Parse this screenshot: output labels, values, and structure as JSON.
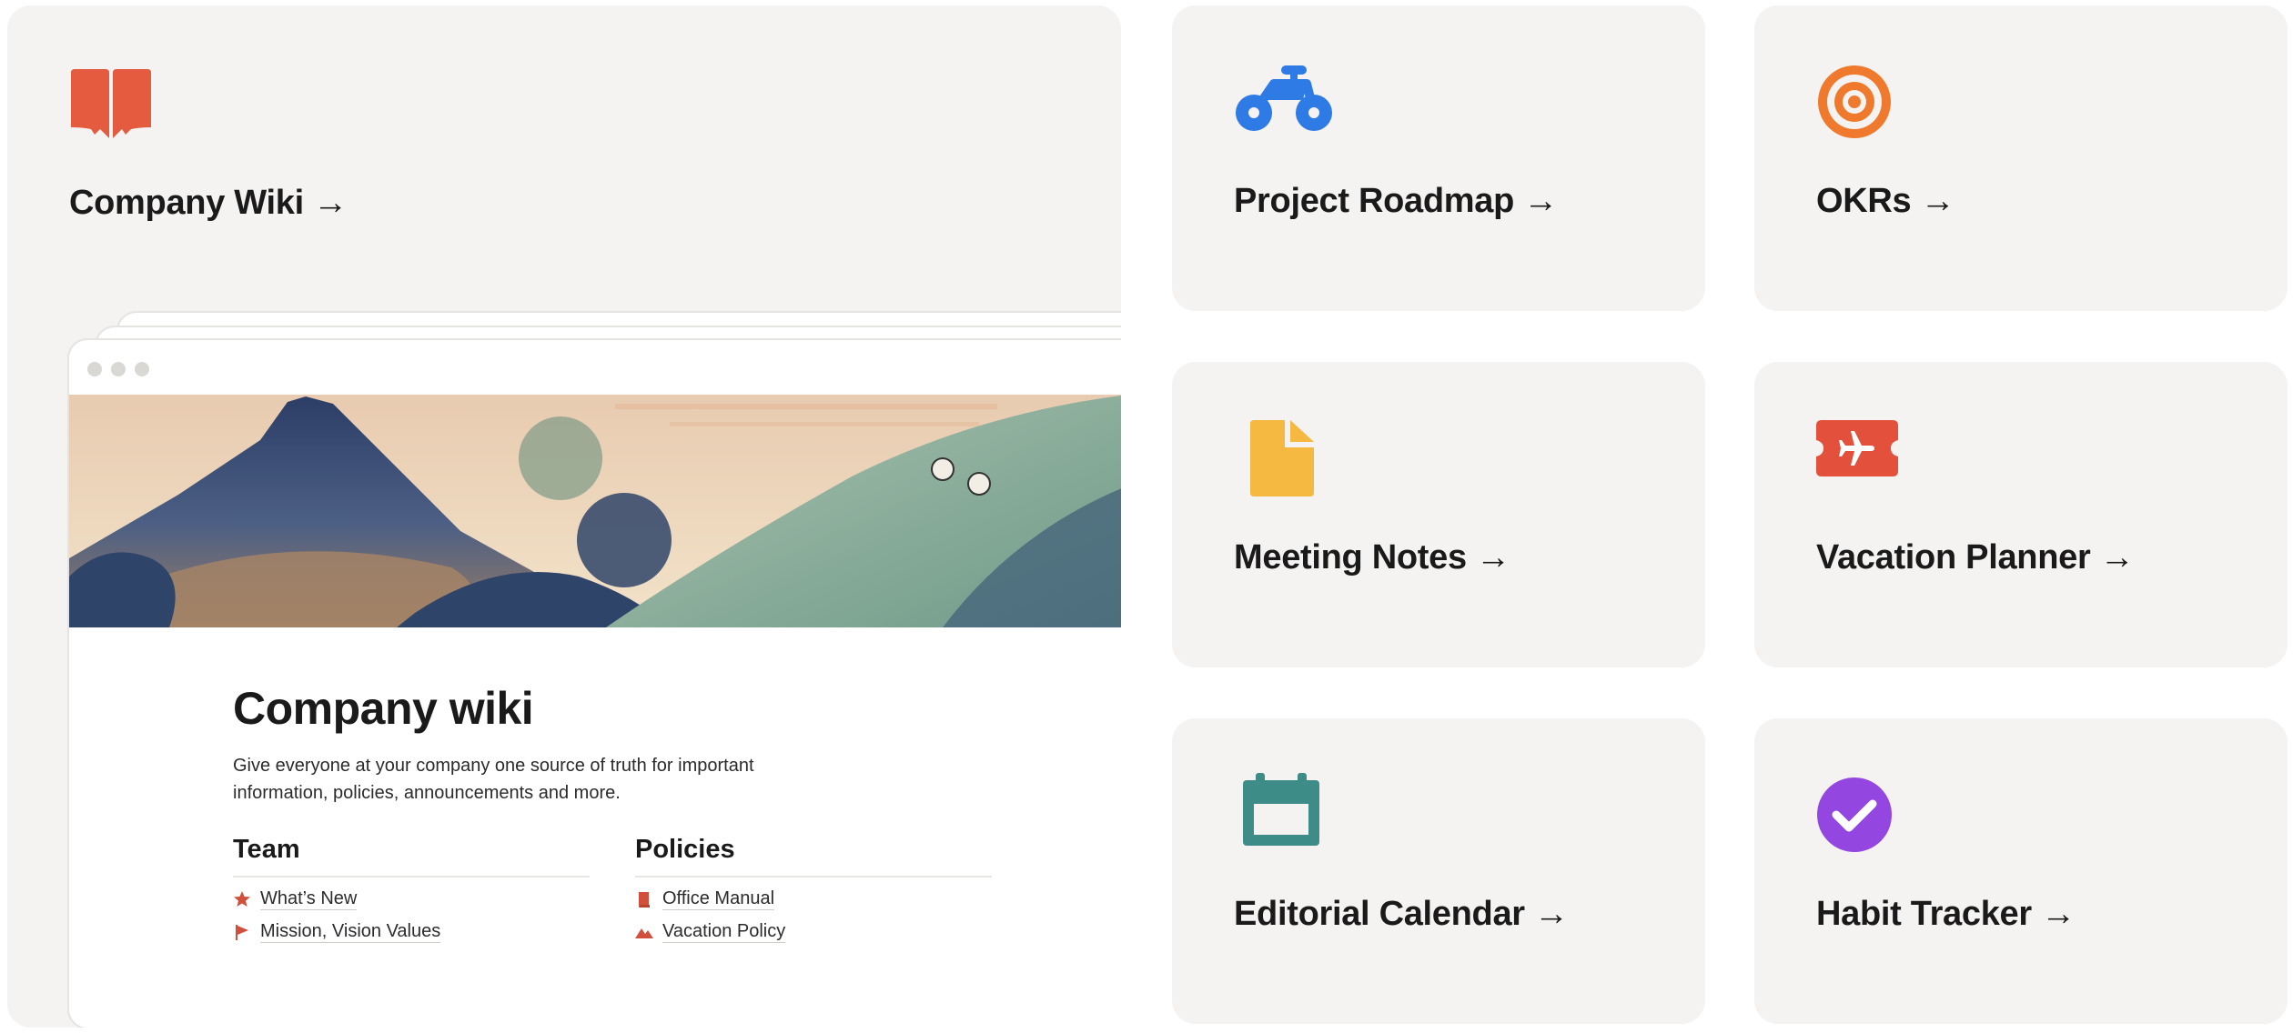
{
  "cards": {
    "wiki": {
      "title": "Company Wiki →",
      "icon": "book-icon",
      "color": "#e55b3f"
    },
    "roadmap": {
      "title": "Project Roadmap →",
      "icon": "bicycle-icon",
      "color": "#2f7be5"
    },
    "okrs": {
      "title": "OKRs →",
      "icon": "target-icon",
      "color": "#ef7a2d"
    },
    "notes": {
      "title": "Meeting Notes →",
      "icon": "document-icon",
      "color": "#f5b942"
    },
    "vacation": {
      "title": "Vacation Planner →",
      "icon": "airplane-ticket-icon",
      "color": "#e3513d"
    },
    "editorial": {
      "title": "Editorial Calendar →",
      "icon": "calendar-icon",
      "color": "#3d8c87"
    },
    "habit": {
      "title": "Habit Tracker →",
      "icon": "checkmark-circle-icon",
      "color": "#9447e0"
    }
  },
  "preview": {
    "title": "Company wiki",
    "description": "Give everyone at your company one source of truth for important information, policies, announcements and more.",
    "team": {
      "heading": "Team",
      "items": [
        {
          "label": "What’s New",
          "icon": "star-icon"
        },
        {
          "label": "Mission, Vision Values",
          "icon": "flag-icon"
        }
      ]
    },
    "policies": {
      "heading": "Policies",
      "items": [
        {
          "label": "Office Manual",
          "icon": "book-small-icon"
        },
        {
          "label": "Vacation Policy",
          "icon": "mountain-icon"
        }
      ]
    }
  }
}
